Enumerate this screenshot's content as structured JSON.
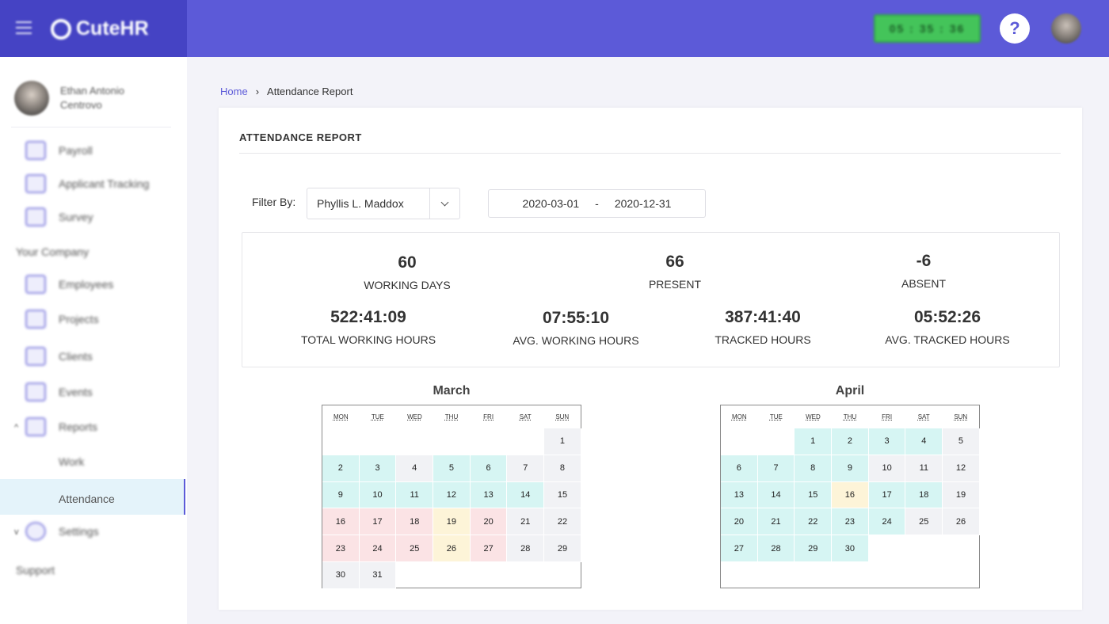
{
  "brand": {
    "name": "CuteHR"
  },
  "header": {
    "timer": "05 : 35 : 36",
    "help_icon": "?"
  },
  "sidebar": {
    "user_name": "Ethan Antonio Centrovo",
    "items_top": [
      {
        "label": "Payroll",
        "icon": "payroll-icon"
      },
      {
        "label": "Applicant Tracking",
        "icon": "applicant-icon"
      },
      {
        "label": "Survey",
        "icon": "survey-icon"
      }
    ],
    "company_section": "Your Company",
    "items_company": [
      {
        "label": "Employees",
        "icon": "employees-icon"
      },
      {
        "label": "Projects",
        "icon": "projects-icon"
      },
      {
        "label": "Clients",
        "icon": "clients-icon"
      },
      {
        "label": "Events",
        "icon": "events-icon"
      },
      {
        "label": "Reports",
        "icon": "reports-icon"
      }
    ],
    "reports_sub": [
      "Work",
      "Attendance"
    ],
    "settings": "Settings",
    "support": "Support"
  },
  "breadcrumb": {
    "home": "Home",
    "current": "Attendance Report"
  },
  "report": {
    "title": "ATTENDANCE REPORT",
    "filter_label": "Filter By:",
    "filter_value": "Phyllis L. Maddox",
    "date_from": "2020-03-01",
    "date_sep": "-",
    "date_to": "2020-12-31",
    "stats": {
      "working_days": {
        "value": "60",
        "label": "WORKING DAYS"
      },
      "present": {
        "value": "66",
        "label": "PRESENT"
      },
      "absent": {
        "value": "-6",
        "label": "ABSENT"
      },
      "total_hours": {
        "value": "522:41:09",
        "label": "TOTAL WORKING HOURS"
      },
      "avg_hours": {
        "value": "07:55:10",
        "label": "AVG. WORKING HOURS"
      },
      "tracked_hours": {
        "value": "387:41:40",
        "label": "TRACKED HOURS"
      },
      "avg_tracked": {
        "value": "05:52:26",
        "label": "AVG. TRACKED HOURS"
      }
    }
  },
  "calendar": {
    "weekdays": [
      "MON",
      "TUE",
      "WED",
      "THU",
      "FRI",
      "SAT",
      "SUN"
    ],
    "colors": {
      "gray": "#f1f2f5",
      "teal": "#d6f5f3",
      "pink": "#fbe3e5",
      "yellow": "#fdf4d8"
    },
    "months": [
      {
        "name": "March",
        "offset": 6,
        "days": [
          {
            "d": "1",
            "s": "gray"
          },
          {
            "d": "2",
            "s": "teal"
          },
          {
            "d": "3",
            "s": "teal"
          },
          {
            "d": "4",
            "s": "gray"
          },
          {
            "d": "5",
            "s": "teal"
          },
          {
            "d": "6",
            "s": "teal"
          },
          {
            "d": "7",
            "s": "gray"
          },
          {
            "d": "8",
            "s": "gray"
          },
          {
            "d": "9",
            "s": "teal"
          },
          {
            "d": "10",
            "s": "teal"
          },
          {
            "d": "11",
            "s": "teal"
          },
          {
            "d": "12",
            "s": "teal"
          },
          {
            "d": "13",
            "s": "teal"
          },
          {
            "d": "14",
            "s": "teal"
          },
          {
            "d": "15",
            "s": "gray"
          },
          {
            "d": "16",
            "s": "pink"
          },
          {
            "d": "17",
            "s": "pink"
          },
          {
            "d": "18",
            "s": "pink"
          },
          {
            "d": "19",
            "s": "yellow"
          },
          {
            "d": "20",
            "s": "pink"
          },
          {
            "d": "21",
            "s": "gray"
          },
          {
            "d": "22",
            "s": "gray"
          },
          {
            "d": "23",
            "s": "pink"
          },
          {
            "d": "24",
            "s": "pink"
          },
          {
            "d": "25",
            "s": "pink"
          },
          {
            "d": "26",
            "s": "yellow"
          },
          {
            "d": "27",
            "s": "pink"
          },
          {
            "d": "28",
            "s": "gray"
          },
          {
            "d": "29",
            "s": "gray"
          },
          {
            "d": "30",
            "s": "gray"
          },
          {
            "d": "31",
            "s": "gray"
          }
        ]
      },
      {
        "name": "April",
        "offset": 2,
        "days": [
          {
            "d": "1",
            "s": "teal"
          },
          {
            "d": "2",
            "s": "teal"
          },
          {
            "d": "3",
            "s": "teal"
          },
          {
            "d": "4",
            "s": "teal"
          },
          {
            "d": "5",
            "s": "gray"
          },
          {
            "d": "6",
            "s": "teal"
          },
          {
            "d": "7",
            "s": "teal"
          },
          {
            "d": "8",
            "s": "teal"
          },
          {
            "d": "9",
            "s": "teal"
          },
          {
            "d": "10",
            "s": "gray"
          },
          {
            "d": "11",
            "s": "gray"
          },
          {
            "d": "12",
            "s": "gray"
          },
          {
            "d": "13",
            "s": "teal"
          },
          {
            "d": "14",
            "s": "teal"
          },
          {
            "d": "15",
            "s": "teal"
          },
          {
            "d": "16",
            "s": "yellow"
          },
          {
            "d": "17",
            "s": "teal"
          },
          {
            "d": "18",
            "s": "teal"
          },
          {
            "d": "19",
            "s": "gray"
          },
          {
            "d": "20",
            "s": "teal"
          },
          {
            "d": "21",
            "s": "teal"
          },
          {
            "d": "22",
            "s": "teal"
          },
          {
            "d": "23",
            "s": "teal"
          },
          {
            "d": "24",
            "s": "teal"
          },
          {
            "d": "25",
            "s": "gray"
          },
          {
            "d": "26",
            "s": "gray"
          },
          {
            "d": "27",
            "s": "teal"
          },
          {
            "d": "28",
            "s": "teal"
          },
          {
            "d": "29",
            "s": "teal"
          },
          {
            "d": "30",
            "s": "teal"
          }
        ]
      }
    ]
  }
}
